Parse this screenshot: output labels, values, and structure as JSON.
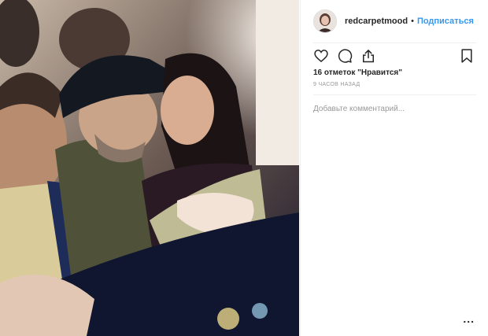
{
  "post": {
    "username": "redcarpetmood",
    "separator": "•",
    "follow_label": "Подписаться",
    "likes_text": "16 отметок \"Нравится\"",
    "time_text": "9 ЧАСОВ НАЗАД",
    "comment_placeholder": "Добавьте комментарий...",
    "more_label": "..."
  },
  "icons": {
    "like": "heart-icon",
    "comment": "comment-icon",
    "share": "share-icon",
    "save": "bookmark-icon",
    "more": "ellipsis-icon"
  },
  "colors": {
    "link": "#3897f0",
    "text": "#262626",
    "muted": "#999999",
    "border": "#efefef"
  }
}
